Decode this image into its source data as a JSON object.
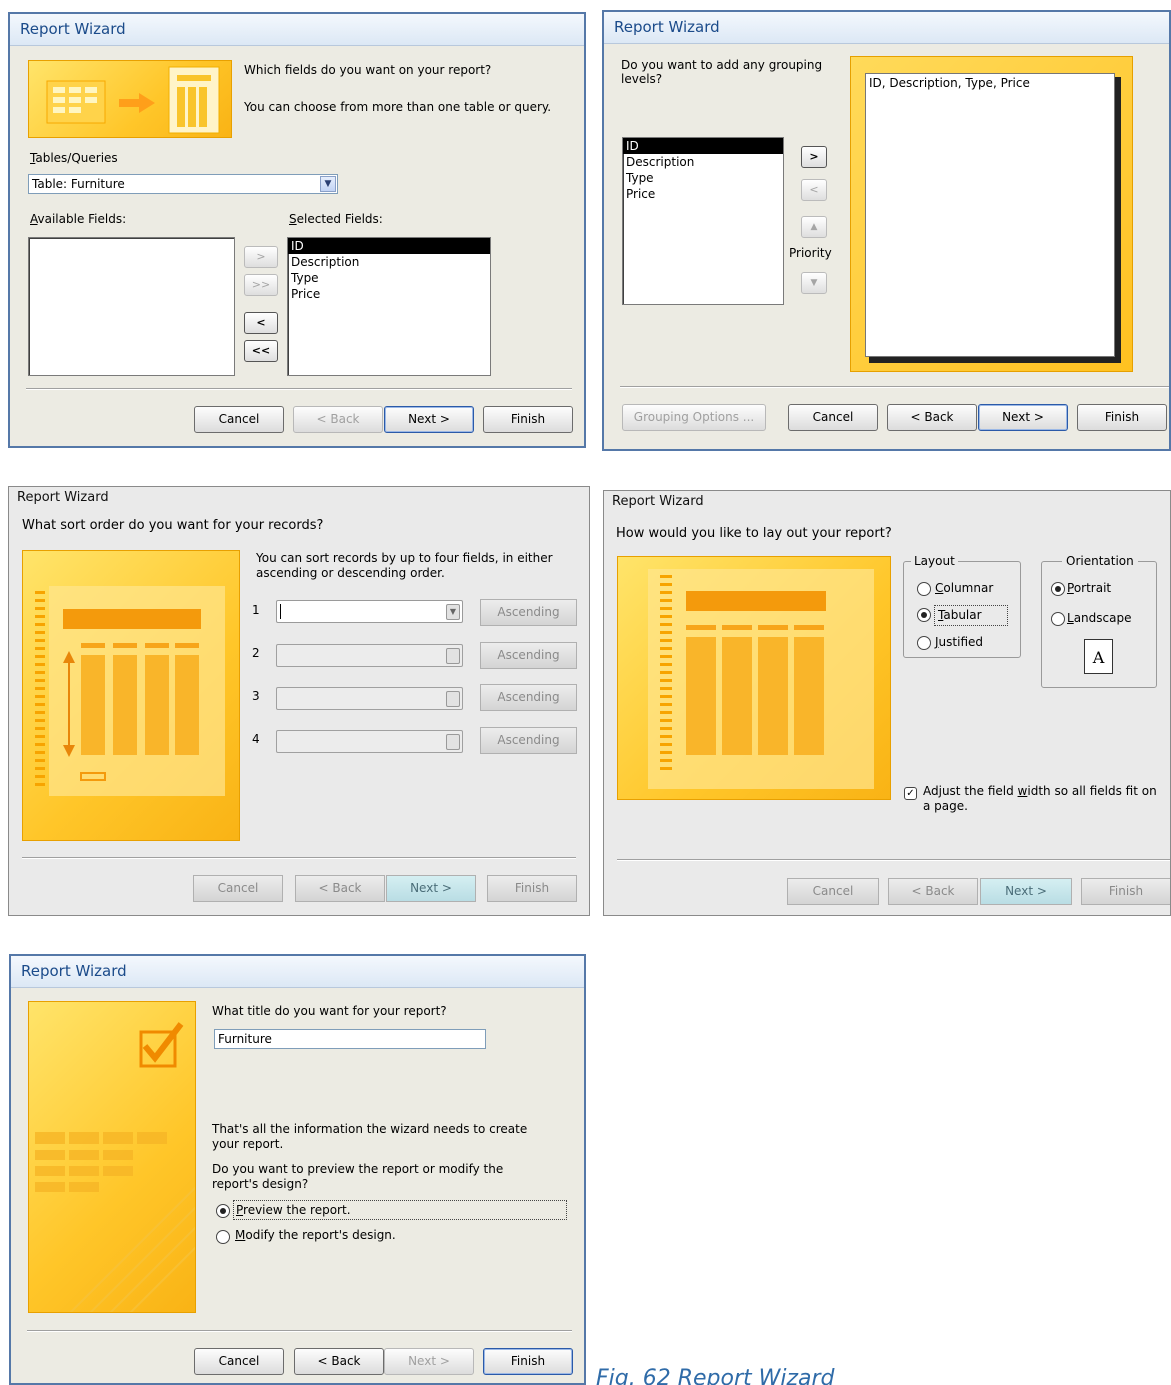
{
  "dialog1": {
    "title": "Report Wizard",
    "question": "Which fields do you want on your report?",
    "hint": "You can choose from more than one table or query.",
    "tables_label": "Tables/Queries",
    "table_selected": "Table: Furniture",
    "available_label": "Available Fields:",
    "selected_label": "Selected Fields:",
    "selected_fields": [
      "ID",
      "Description",
      "Type",
      "Price"
    ],
    "move_buttons": [
      ">",
      ">>",
      "<",
      "<<"
    ],
    "buttons": {
      "cancel": "Cancel",
      "back": "< Back",
      "next": "Next >",
      "finish": "Finish"
    }
  },
  "dialog2": {
    "title": "Report Wizard",
    "question": "Do you want to add any grouping levels?",
    "fields": [
      "ID",
      "Description",
      "Type",
      "Price"
    ],
    "preview_text": "ID, Description, Type, Price",
    "add_button": ">",
    "remove_button": "<",
    "priority_label": "Priority",
    "up_icon": "arrow-up-icon",
    "down_icon": "arrow-down-icon",
    "buttons": {
      "grouping_options": "Grouping Options ...",
      "cancel": "Cancel",
      "back": "< Back",
      "next": "Next >",
      "finish": "Finish"
    }
  },
  "dialog3": {
    "title": "Report Wizard",
    "question": "What sort order do you want for your records?",
    "hint": "You can sort records by up to four fields, in either ascending or descending order.",
    "sort_rows": [
      {
        "num": "1",
        "order": "Ascending"
      },
      {
        "num": "2",
        "order": "Ascending"
      },
      {
        "num": "3",
        "order": "Ascending"
      },
      {
        "num": "4",
        "order": "Ascending"
      }
    ],
    "buttons": {
      "cancel": "Cancel",
      "back": "< Back",
      "next": "Next >",
      "finish": "Finish"
    }
  },
  "dialog4": {
    "title": "Report Wizard",
    "question": "How would you like to lay out your report?",
    "layout_label": "Layout",
    "layout_options": [
      "Columnar",
      "Tabular",
      "Justified"
    ],
    "layout_selected": "Tabular",
    "orientation_label": "Orientation",
    "orientation_options": [
      "Portrait",
      "Landscape"
    ],
    "orientation_selected": "Portrait",
    "page_letter": "A",
    "adjust_label": "Adjust the field width so all fields fit on a page.",
    "adjust_checked": true,
    "buttons": {
      "cancel": "Cancel",
      "back": "< Back",
      "next": "Next >",
      "finish": "Finish"
    }
  },
  "dialog5": {
    "title": "Report Wizard",
    "question": "What title do you want for your report?",
    "report_title": "Furniture",
    "info": "That's all the information the wizard needs to create your report.",
    "preview_question": "Do you want to preview the report or modify the report's design?",
    "options": [
      "Preview the report.",
      "Modify the report's design."
    ],
    "option_selected": "Preview the report.",
    "buttons": {
      "cancel": "Cancel",
      "back": "< Back",
      "next": "Next >",
      "finish": "Finish"
    }
  },
  "caption": "Fig. 62 Report Wizard",
  "colors": {
    "accent_yellow": "#ffc629",
    "title_blue": "#1b4b8a",
    "caption_blue": "#2f6ba8"
  }
}
